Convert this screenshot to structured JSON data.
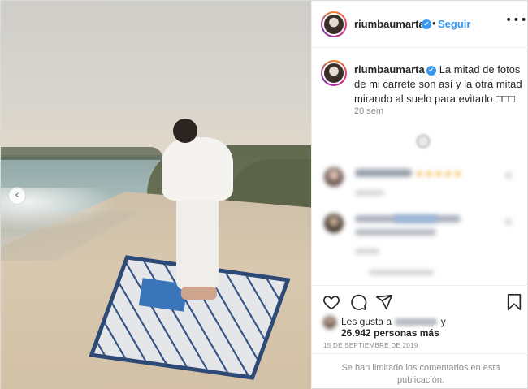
{
  "post": {
    "username": "riumbaumarta",
    "follow_label": "Seguir",
    "separator": "•",
    "more_label": "•••",
    "verified_mark": "✔",
    "carousel_prev": "‹"
  },
  "caption": {
    "username": "riumbaumarta",
    "text": "La mitad de fotos de mi carrete son así y la otra mitad mirando al suelo para evitarlo □□□",
    "time_ago": "20 sem"
  },
  "comments": {
    "stars": "★★★★★"
  },
  "icons": {
    "like": "heart-icon",
    "comment": "comment-icon",
    "share": "paper-plane-icon",
    "save": "bookmark-icon",
    "options": "more-dots-icon",
    "verified": "verified-badge-icon",
    "carousel": "chevron-left-icon"
  },
  "likes": {
    "prefix": "Les gusta a",
    "suffix": "y",
    "count_text": "26.942 personas más"
  },
  "date": "15 DE SEPTIEMBRE DE 2019",
  "limited_comments": "Se han limitado los comentarios en esta publicación.",
  "colors": {
    "accent": "#3897f0",
    "text": "#262626",
    "muted": "#8e8e8e",
    "border": "#efefef"
  }
}
